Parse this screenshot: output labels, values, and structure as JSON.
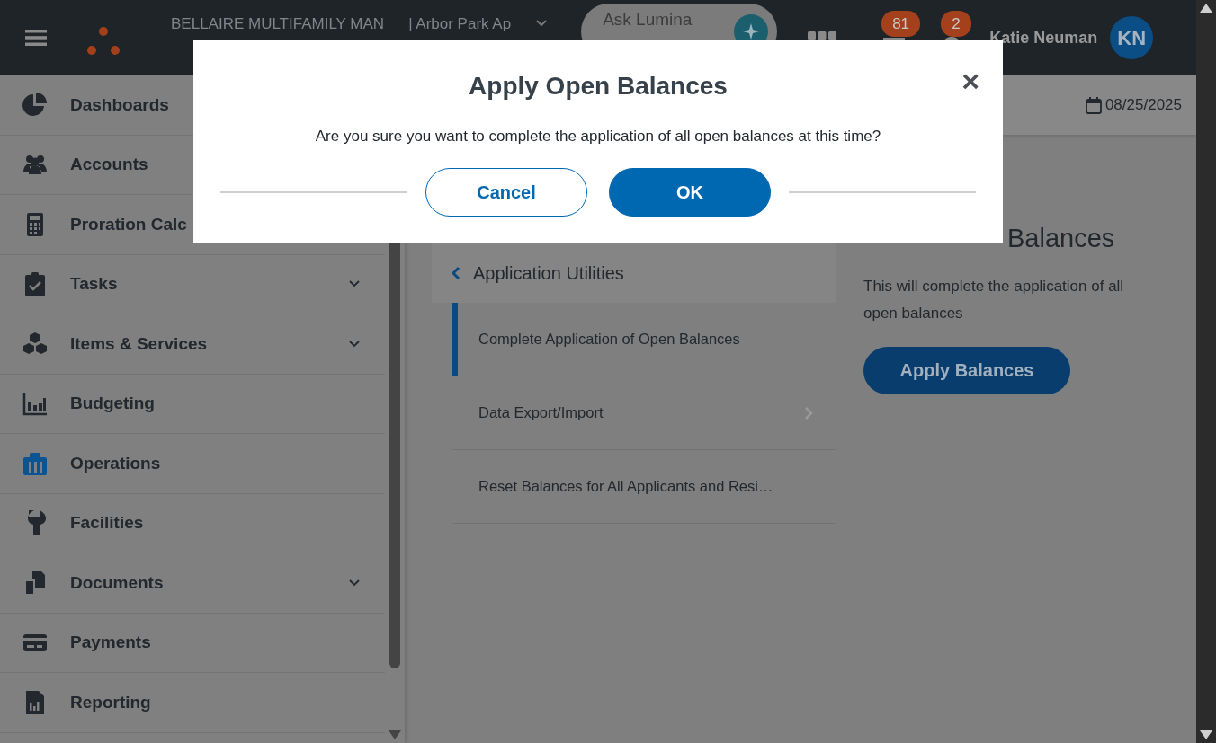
{
  "header": {
    "org": "BELLAIRE MULTIFAMILY MAN",
    "property": "| Arbor Park Ap",
    "search": {
      "placeholder": "Ask Lumina"
    },
    "messages_badge": "81",
    "help_badge": "2",
    "user_name": "Katie Neuman",
    "avatar": "KN"
  },
  "sidebar": {
    "items": [
      {
        "label": "Dashboards",
        "expandable": false,
        "selected": false
      },
      {
        "label": "Accounts",
        "expandable": false,
        "selected": false
      },
      {
        "label": "Proration Calc",
        "expandable": false,
        "selected": false
      },
      {
        "label": "Tasks",
        "expandable": true,
        "selected": false
      },
      {
        "label": "Items & Services",
        "expandable": true,
        "selected": false
      },
      {
        "label": "Budgeting",
        "expandable": false,
        "selected": false
      },
      {
        "label": "Operations",
        "expandable": false,
        "selected": true
      },
      {
        "label": "Facilities",
        "expandable": false,
        "selected": false
      },
      {
        "label": "Documents",
        "expandable": true,
        "selected": false
      },
      {
        "label": "Payments",
        "expandable": false,
        "selected": false
      },
      {
        "label": "Reporting",
        "expandable": false,
        "selected": false
      }
    ]
  },
  "toolbar": {
    "date": "08/25/2025"
  },
  "utilities": {
    "title": "Application Utilities",
    "items": [
      {
        "label": "Complete Application of Open Balances",
        "selected": true,
        "has_submenu": false
      },
      {
        "label": "Data Export/Import",
        "selected": false,
        "has_submenu": true
      },
      {
        "label": "Reset Balances for All Applicants and Resi…",
        "selected": false,
        "has_submenu": false
      }
    ]
  },
  "detail": {
    "heading": "Balances",
    "description": "This will complete the application of all open balances",
    "button": "Apply Balances"
  },
  "modal": {
    "title": "Apply Open Balances",
    "close": "×",
    "message": "Are you sure you want to complete the application of all open balances at this time?",
    "buttons": [
      {
        "label": "Cancel",
        "kind": "secondary"
      },
      {
        "label": "OK",
        "kind": "primary"
      }
    ]
  }
}
